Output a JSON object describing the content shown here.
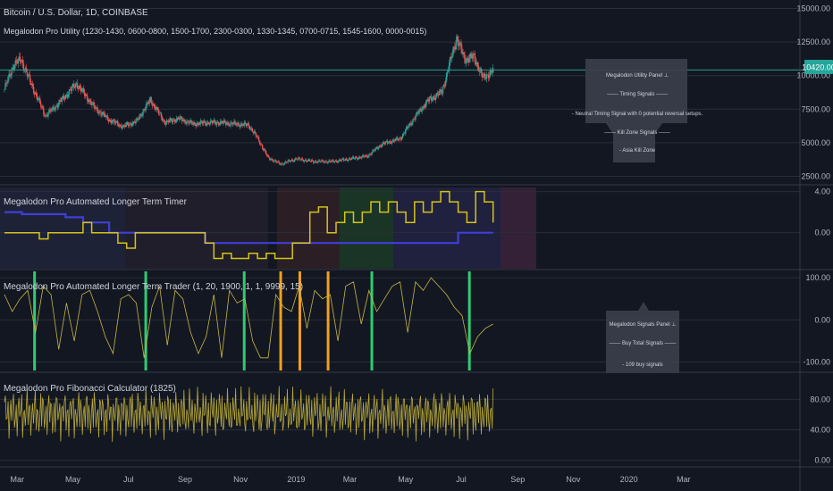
{
  "chart_data": [
    {
      "type": "line",
      "subtype": "candlestick",
      "title": "Bitcoin / U.S. Dollar, 1D, COINBASE",
      "subtitle": "Megalodon Pro Utility (1230-1430, 0600-0800, 1500-1700, 2300-0300, 1330-1345, 0700-0715, 1545-1600, 0000-0015)",
      "y_ticks": [
        "2500.00",
        "5000.00",
        "7500.00",
        "10000.00",
        "12500.00",
        "15000.00"
      ],
      "last_price": "10420.00",
      "ylim": [
        2000,
        15300
      ],
      "series": [
        {
          "x": [
            "2018-02-15",
            "2018-02-25",
            "2018-03-05",
            "2018-03-20",
            "2018-04-01",
            "2018-04-15",
            "2018-05-05",
            "2018-05-25",
            "2018-06-10",
            "2018-06-25",
            "2018-07-10",
            "2018-07-25",
            "2018-08-10",
            "2018-08-25",
            "2018-09-10",
            "2018-09-25",
            "2018-10-10",
            "2018-10-25",
            "2018-11-10",
            "2018-11-20",
            "2018-12-01",
            "2018-12-15",
            "2019-01-01",
            "2019-01-20",
            "2019-02-10",
            "2019-03-01",
            "2019-03-20",
            "2019-04-05",
            "2019-04-25",
            "2019-05-10",
            "2019-05-25",
            "2019-06-10",
            "2019-06-26",
            "2019-07-05",
            "2019-07-15",
            "2019-07-25",
            "2019-08-05"
          ],
          "values": [
            9000,
            10800,
            11200,
            8800,
            7000,
            7900,
            9400,
            7600,
            6700,
            6200,
            6600,
            8200,
            6500,
            6800,
            6400,
            6500,
            6500,
            6400,
            6300,
            5300,
            3900,
            3400,
            3800,
            3600,
            3600,
            3800,
            4000,
            4900,
            5300,
            6800,
            8100,
            8800,
            12800,
            11200,
            11400,
            9800,
            10400
          ]
        }
      ],
      "annotations": [
        {
          "title": "Megalodon Utility Panel ⊥",
          "lines": [
            "─── Timing Signals ───",
            "- Neutral Timing Signal with 0 potential reversal setups.",
            "─── Kill Zone Signals ───",
            "- Asia Kill Zone"
          ]
        }
      ]
    },
    {
      "type": "line",
      "title": "Megalodon Pro Automated Longer Term Timer",
      "y_ticks": [
        "4.00",
        "0.00"
      ],
      "ylim": [
        -3.5,
        4.4
      ],
      "series": [
        {
          "values": [
            0,
            0,
            0,
            0,
            -0.6,
            0,
            0,
            0,
            0,
            1,
            0,
            0,
            0,
            -1,
            -1.5,
            0,
            0,
            0,
            0,
            0,
            0,
            0,
            0,
            -1,
            -2.5,
            -2,
            -2.5,
            -2.5,
            -2,
            -2.5,
            -2,
            -2.5,
            -2.5,
            -1,
            -1,
            2,
            2.5,
            0,
            1,
            2,
            1,
            2,
            3,
            2,
            3,
            2,
            1,
            3,
            2,
            3,
            4,
            3,
            2,
            1,
            4,
            3,
            1
          ]
        },
        {
          "values": [
            2,
            2,
            1.8,
            1.8,
            1.8,
            1.8,
            1.8,
            1.5,
            1.5,
            1,
            1,
            1,
            0,
            0,
            0,
            0,
            0,
            0,
            0,
            0,
            0,
            0,
            0,
            -1,
            -1,
            -1,
            -1,
            -1,
            -1,
            -1,
            -1,
            -1,
            -1,
            -1,
            -1,
            -1,
            -1,
            -1,
            -1,
            -1,
            -1,
            -1,
            -1,
            -1,
            -1,
            -1,
            -1,
            -1,
            -1,
            -1,
            -1,
            -1,
            0,
            0,
            0,
            0,
            0
          ]
        }
      ]
    },
    {
      "type": "line",
      "title": "Megalodon Pro Automated Longer Term Trader (1, 20, 1900, 1, 1, 9999, 15)",
      "y_ticks": [
        "100.00",
        "0.00",
        "-100.00"
      ],
      "ylim": [
        -120,
        115
      ],
      "series": [
        {
          "values": [
            60,
            20,
            50,
            70,
            -30,
            80,
            60,
            -70,
            40,
            -50,
            60,
            70,
            20,
            -40,
            -80,
            50,
            60,
            40,
            -90,
            30,
            80,
            -60,
            70,
            50,
            -30,
            -80,
            -40,
            60,
            -90,
            70,
            40,
            50,
            -50,
            -90,
            -90,
            60,
            30,
            20,
            80,
            -20,
            70,
            50,
            60,
            -50,
            80,
            90,
            -10,
            70,
            20,
            50,
            80,
            90,
            -30,
            90,
            70,
            100,
            80,
            60,
            30,
            10,
            -80,
            -40,
            -20,
            -10
          ]
        }
      ],
      "annotations": [
        {
          "title": "Megalodon Signals Panel ⊥",
          "lines": [
            "─── Buy Total Signals ───",
            "- 109 buy signals"
          ]
        }
      ]
    },
    {
      "type": "line",
      "title": "Megalodon Pro Fibonacci Calculator (1825)",
      "y_ticks": [
        "80.00",
        "40.00",
        "0.00"
      ],
      "ylim": [
        -5,
        112
      ]
    }
  ],
  "x_ticks": [
    "Mar",
    "May",
    "Jul",
    "Sep",
    "Nov",
    "2019",
    "Mar",
    "May",
    "Jul",
    "Sep",
    "Nov",
    "2020",
    "Mar"
  ],
  "colors": {
    "background": "#131722",
    "up": "#26a69a",
    "down": "#ef5350",
    "timer_line": "#d4c319",
    "timer_baseline": "#3f3fd8",
    "trader_line": "#c7b745",
    "fib_line": "#b8a93a",
    "buy_signal": "#2ecc71",
    "sell_signal": "#f0a020",
    "price_line": "#2a9d8f",
    "price_badge": "#26a69a"
  }
}
